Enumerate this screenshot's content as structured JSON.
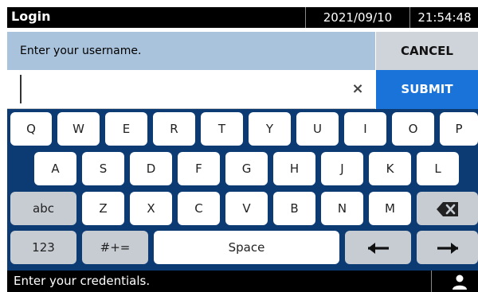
{
  "header": {
    "title": "Login",
    "date": "2021/09/10",
    "time": "21:54:48"
  },
  "prompt": {
    "text": "Enter your username.",
    "cancel_label": "CANCEL",
    "submit_label": "SUBMIT"
  },
  "input": {
    "value": "",
    "clear_icon": "×"
  },
  "keyboard": {
    "row1": [
      "Q",
      "W",
      "E",
      "R",
      "T",
      "Y",
      "U",
      "I",
      "O",
      "P"
    ],
    "row2": [
      "A",
      "S",
      "D",
      "F",
      "G",
      "H",
      "J",
      "K",
      "L"
    ],
    "row3": [
      "Z",
      "X",
      "C",
      "V",
      "B",
      "N",
      "M"
    ],
    "abc_label": "abc",
    "num_label": "123",
    "sym_label": "#+=",
    "space_label": "Space",
    "backspace_icon": "backspace-icon",
    "left_icon": "arrow-left-icon",
    "right_icon": "arrow-right-icon"
  },
  "status": {
    "text": "Enter your credentials.",
    "user_icon": "user-icon"
  },
  "colors": {
    "keyboard_bg": "#0c3b74",
    "submit_bg": "#1a73d9",
    "prompt_bg": "#a9c3dc"
  }
}
